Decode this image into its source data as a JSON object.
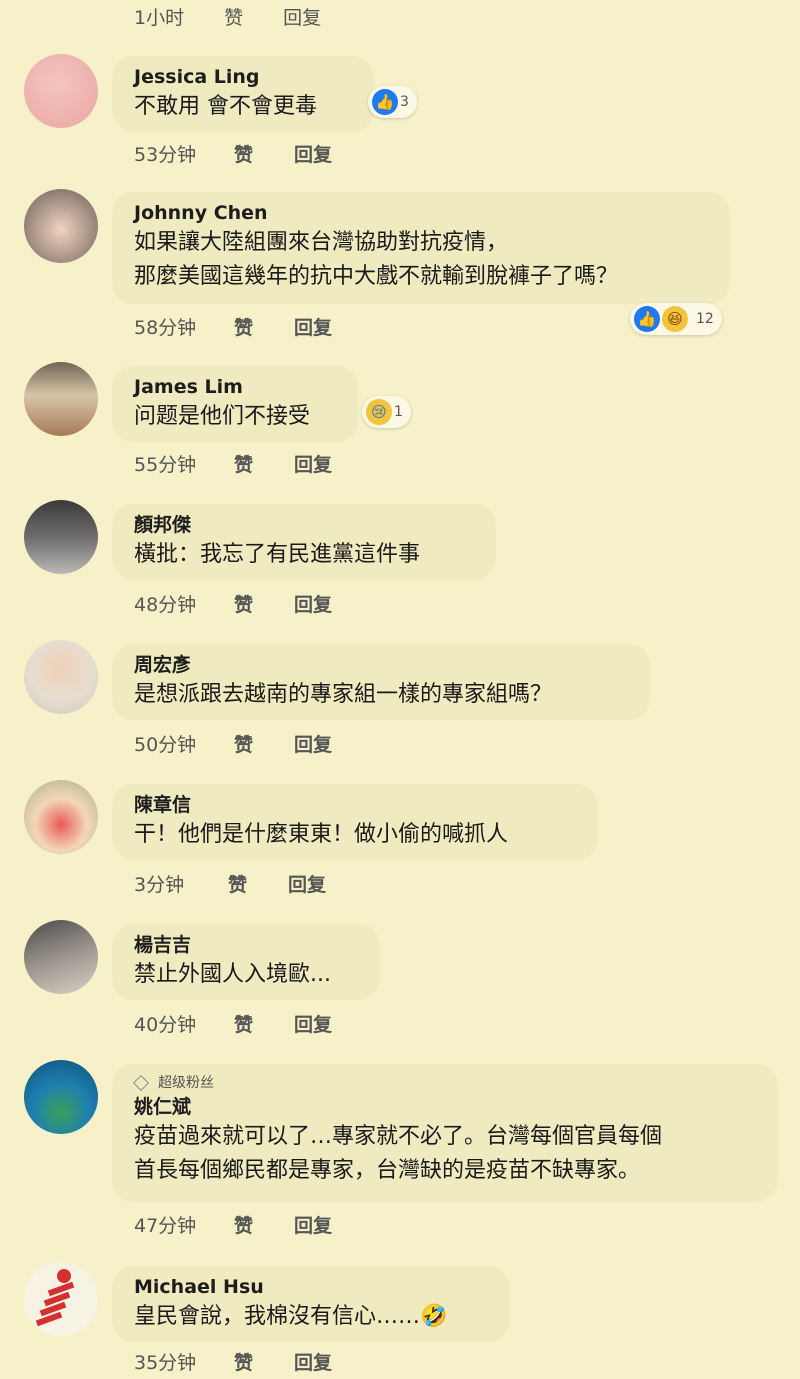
{
  "top": {
    "time": "1小时",
    "like": "赞",
    "reply": "回复"
  },
  "comments": [
    {
      "name": "Jessica Ling",
      "text": [
        "不敢用 會不會更毒"
      ],
      "time": "53分钟",
      "like": "赞",
      "reply": "回复",
      "reactions": [
        "thumbs-up"
      ],
      "reaction_count": "3"
    },
    {
      "name": "Johnny Chen",
      "text": [
        "如果讓大陸組團來台灣協助對抗疫情，",
        "那麼美國這幾年的抗中大戲不就輸到脫褲子了嗎？"
      ],
      "time": "58分钟",
      "like": "赞",
      "reply": "回复",
      "reactions": [
        "thumbs-up",
        "haha"
      ],
      "reaction_count": "12"
    },
    {
      "name": "James Lim",
      "text": [
        "问题是他们不接受"
      ],
      "time": "55分钟",
      "like": "赞",
      "reply": "回复",
      "reactions": [
        "sad"
      ],
      "reaction_count": "1"
    },
    {
      "name": "顏邦傑",
      "text": [
        "橫批：我忘了有民進黨這件事"
      ],
      "time": "48分钟",
      "like": "赞",
      "reply": "回复"
    },
    {
      "name": "周宏彥",
      "text": [
        "是想派跟去越南的專家組一樣的專家組嗎？"
      ],
      "time": "50分钟",
      "like": "赞",
      "reply": "回复"
    },
    {
      "name": "陳章信",
      "text": [
        "干！他們是什麼東東！做小偷的喊抓人"
      ],
      "time": "3分钟",
      "like": "赞",
      "reply": "回复"
    },
    {
      "name": "楊吉吉",
      "text": [
        "禁止外國人入境歐..."
      ],
      "time": "40分钟",
      "like": "赞",
      "reply": "回复"
    },
    {
      "badge": "超级粉丝",
      "name": "姚仁斌",
      "text": [
        "疫苗過來就可以了…專家就不必了。台灣每個官員每個",
        "首長每個鄉民都是專家，台灣缺的是疫苗不缺專家。"
      ],
      "time": "47分钟",
      "like": "赞",
      "reply": "回复"
    },
    {
      "name": "Michael Hsu",
      "text": [
        "皇民會說，我棉沒有信心……🤣"
      ],
      "time": "35分钟",
      "like": "赞",
      "reply": "回复"
    }
  ],
  "colors": {
    "background": "#f6f1c9",
    "bubble": "#efeabf",
    "like_blue": "#1d7bf2",
    "emoji_yellow": "#f4c33c"
  }
}
